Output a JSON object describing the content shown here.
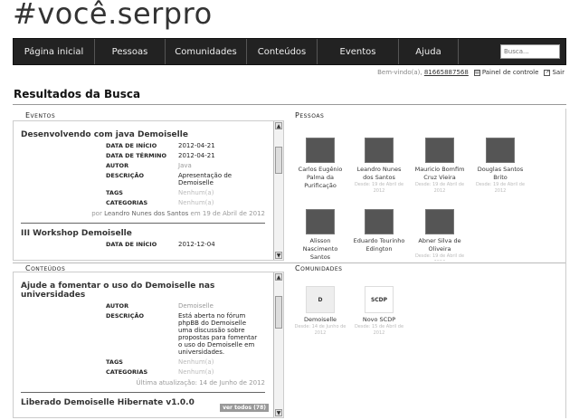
{
  "site": {
    "logo": "#você.serpro"
  },
  "nav": {
    "items": [
      "Página inicial",
      "Pessoas",
      "Comunidades",
      "Conteúdos",
      "Eventos",
      "Ajuda"
    ],
    "search_placeholder": "Busca..."
  },
  "userbar": {
    "welcome": "Bem-vindo(a),",
    "user_id": "81665887568",
    "panel": "Painel de controle",
    "logout": "Sair"
  },
  "page": {
    "title": "Resultados da Busca"
  },
  "events": {
    "heading": "Eventos",
    "items": [
      {
        "title": "Desenvolvendo com java Demoiselle",
        "fields": [
          {
            "k": "DATA DE INÍCIO",
            "v": "2012-04-21",
            "muted": false
          },
          {
            "k": "DATA DE TÉRMINO",
            "v": "2012-04-21",
            "muted": false
          },
          {
            "k": "AUTOR",
            "v": "Java",
            "muted": false
          },
          {
            "k": "DESCRIÇÃO",
            "v": "Apresentação de Demoiselle",
            "muted": false
          },
          {
            "k": "TAGS",
            "v": "Nenhum(a)",
            "muted": true
          },
          {
            "k": "CATEGORIAS",
            "v": "Nenhum(a)",
            "muted": true
          }
        ],
        "by_prefix": "por",
        "by_name": "Leandro Nunes dos Santos",
        "by_suffix": "em 19 de Abril de 2012"
      },
      {
        "title": "III Workshop Demoiselle",
        "fields": [
          {
            "k": "DATA DE INÍCIO",
            "v": "2012-12-04",
            "muted": false
          }
        ]
      }
    ]
  },
  "contents": {
    "heading": "Conteúdos",
    "items": [
      {
        "title": "Ajude a fomentar o uso do Demoiselle nas universidades",
        "fields": [
          {
            "k": "AUTOR",
            "v": "Demoiselle",
            "muted": false
          },
          {
            "k": "DESCRIÇÃO",
            "v": "Está aberta no fórum phpBB do Demoiselle uma discussão sobre propostas para fomentar o uso do Demoiselle em universidades.",
            "muted": false
          },
          {
            "k": "TAGS",
            "v": "Nenhum(a)",
            "muted": true
          },
          {
            "k": "CATEGORIAS",
            "v": "Nenhum(a)",
            "muted": true
          }
        ],
        "updated": "Última atualização: 14 de Junho de 2012"
      },
      {
        "title": "Liberado Demoiselle Hibernate v1.0.0"
      }
    ],
    "see_all": "ver todos (78)"
  },
  "people": {
    "heading": "Pessoas",
    "items": [
      {
        "name": "Carlos Eugênio Palma da Purificação",
        "date": ""
      },
      {
        "name": "Leandro Nunes dos Santos",
        "date": "Desde: 19 de Abril de 2012"
      },
      {
        "name": "Mauricio Bomfim Cruz Vieira",
        "date": "Desde: 19 de Abril de 2012"
      },
      {
        "name": "Douglas Santos Brito",
        "date": "Desde: 19 de Abril de 2012"
      },
      {
        "name": "Alisson Nascimento Santos",
        "date": ""
      },
      {
        "name": "Eduardo Tourinho Edington",
        "date": ""
      },
      {
        "name": "Abner Silva de Oliveira",
        "date": "Desde: 19 de Abril de 2012"
      }
    ]
  },
  "communities": {
    "heading": "Comunidades",
    "items": [
      {
        "name": "Demoiselle",
        "date": "Desde: 14 de Junho de 2012",
        "img_label": "D"
      },
      {
        "name": "Novo SCDP",
        "date": "Desde: 15 de Abril de 2012",
        "img_label": "SCDP"
      }
    ]
  }
}
